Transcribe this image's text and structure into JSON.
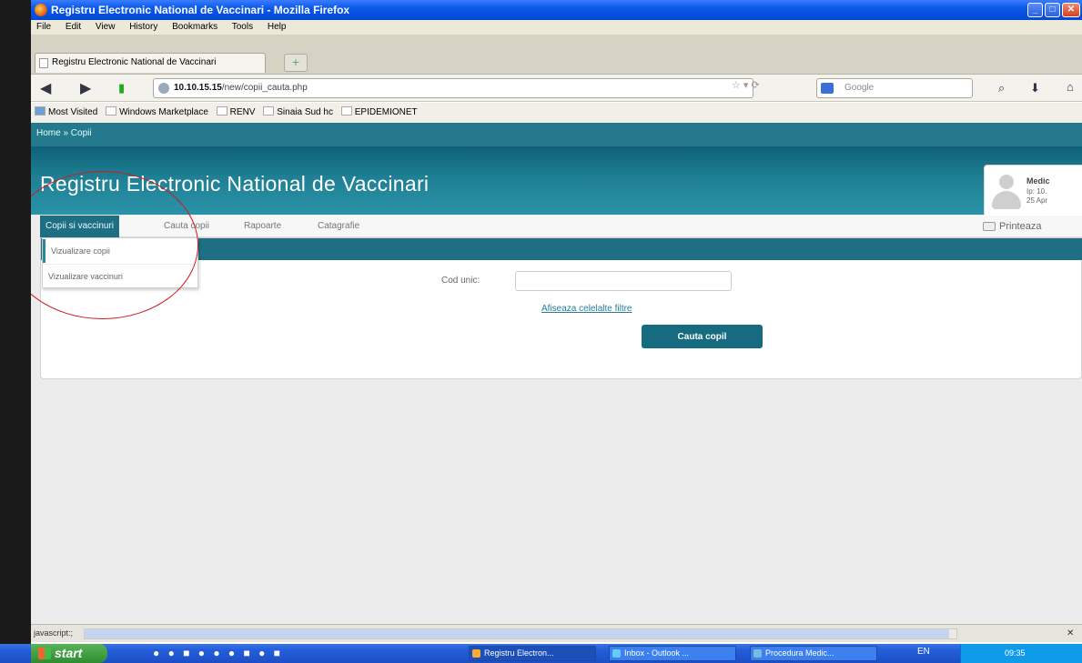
{
  "window": {
    "title": "Registru Electronic National de Vaccinari - Mozilla Firefox",
    "controls": [
      "minimize",
      "maximize",
      "close"
    ]
  },
  "menubar": [
    "File",
    "Edit",
    "View",
    "History",
    "Bookmarks",
    "Tools",
    "Help"
  ],
  "tabs": [
    {
      "label": "Registru Electronic National de Vaccinari",
      "active": true
    }
  ],
  "newtab_label": "+",
  "navbar": {
    "url_host": "10.10.15.15",
    "url_path": "/new/copii_cauta.php",
    "search_placeholder": "Google"
  },
  "bookmarks": [
    "Most Visited",
    "Windows Marketplace",
    "RENV",
    "Sinaia Sud hc",
    "EPIDEMIONET"
  ],
  "site": {
    "breadcrumb": "Home » Copii",
    "title": "Registru Electronic National de Vaccinari",
    "user": {
      "name": "Medic",
      "ip": "Ip: 10.",
      "date": "25 Apr"
    },
    "nav": [
      "Copii si vaccinuri",
      "Cauta copii",
      "Rapoarte",
      "Catagrafie"
    ],
    "print_label": "Printeaza",
    "dropdown": [
      "Vizualizare copii",
      "Vizualizare vaccinuri"
    ],
    "search": {
      "cod_label": "Cod unic:",
      "cod_value": "",
      "filters_link": "Afiseaza celelalte filtre",
      "button_label": "Cauta copil"
    }
  },
  "statusbar": {
    "text": "javascript:;"
  },
  "taskbar": {
    "start_label": "start",
    "tasks": [
      "Registru Electron...",
      "Inbox - Outlook ...",
      "Procedura Medic..."
    ],
    "language": "EN",
    "clock": "09:35"
  },
  "colors": {
    "header": "#1f7f94",
    "accent": "#176b80",
    "annotation": "#d21a1a"
  }
}
